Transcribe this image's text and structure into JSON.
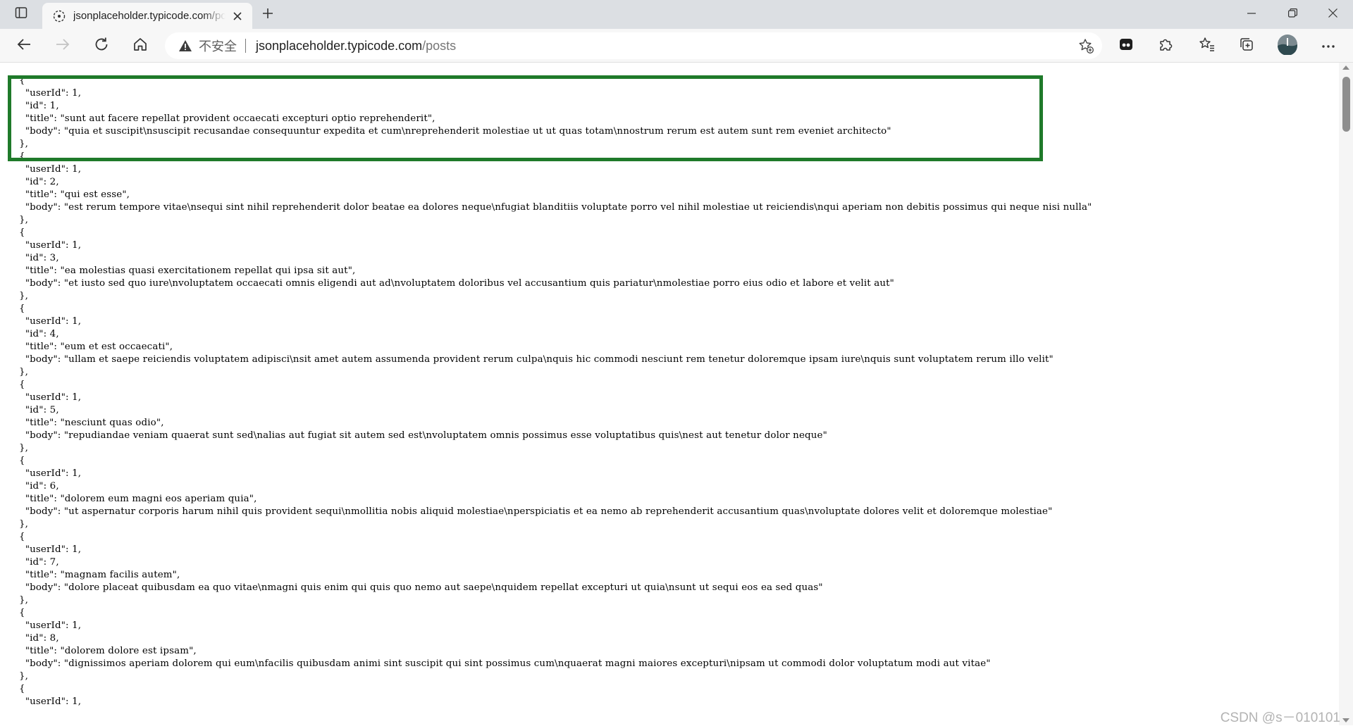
{
  "tab": {
    "title": "jsonplaceholder.typicode.com/posts"
  },
  "address_bar": {
    "security_label": "不安全",
    "host": "jsonplaceholder.typicode.com",
    "path": "/posts"
  },
  "icons": {
    "tab_actions": "tab-actions-icon",
    "favicon": "site-icon",
    "back": "back-arrow-icon",
    "forward": "forward-arrow-icon",
    "refresh": "refresh-icon",
    "home": "home-icon",
    "warning": "warning-icon",
    "add_favorite": "star-add-icon",
    "extensions": "puzzle-icon",
    "favorites": "favorites-icon",
    "collections": "collections-icon",
    "profile": "avatar",
    "menu": "more-icon"
  },
  "colors": {
    "highlight_border": "#1f7a2a"
  },
  "json_text": "{\n  \"userId\": 1,\n  \"id\": 1,\n  \"title\": \"sunt aut facere repellat provident occaecati excepturi optio reprehenderit\",\n  \"body\": \"quia et suscipit\\nsuscipit recusandae consequuntur expedita et cum\\nreprehenderit molestiae ut ut quas totam\\nnostrum rerum est autem sunt rem eveniet architecto\"\n},\n{\n  \"userId\": 1,\n  \"id\": 2,\n  \"title\": \"qui est esse\",\n  \"body\": \"est rerum tempore vitae\\nsequi sint nihil reprehenderit dolor beatae ea dolores neque\\nfugiat blanditiis voluptate porro vel nihil molestiae ut reiciendis\\nqui aperiam non debitis possimus qui neque nisi nulla\"\n},\n{\n  \"userId\": 1,\n  \"id\": 3,\n  \"title\": \"ea molestias quasi exercitationem repellat qui ipsa sit aut\",\n  \"body\": \"et iusto sed quo iure\\nvoluptatem occaecati omnis eligendi aut ad\\nvoluptatem doloribus vel accusantium quis pariatur\\nmolestiae porro eius odio et labore et velit aut\"\n},\n{\n  \"userId\": 1,\n  \"id\": 4,\n  \"title\": \"eum et est occaecati\",\n  \"body\": \"ullam et saepe reiciendis voluptatem adipisci\\nsit amet autem assumenda provident rerum culpa\\nquis hic commodi nesciunt rem tenetur doloremque ipsam iure\\nquis sunt voluptatem rerum illo velit\"\n},\n{\n  \"userId\": 1,\n  \"id\": 5,\n  \"title\": \"nesciunt quas odio\",\n  \"body\": \"repudiandae veniam quaerat sunt sed\\nalias aut fugiat sit autem sed est\\nvoluptatem omnis possimus esse voluptatibus quis\\nest aut tenetur dolor neque\"\n},\n{\n  \"userId\": 1,\n  \"id\": 6,\n  \"title\": \"dolorem eum magni eos aperiam quia\",\n  \"body\": \"ut aspernatur corporis harum nihil quis provident sequi\\nmollitia nobis aliquid molestiae\\nperspiciatis et ea nemo ab reprehenderit accusantium quas\\nvoluptate dolores velit et doloremque molestiae\"\n},\n{\n  \"userId\": 1,\n  \"id\": 7,\n  \"title\": \"magnam facilis autem\",\n  \"body\": \"dolore placeat quibusdam ea quo vitae\\nmagni quis enim qui quis quo nemo aut saepe\\nquidem repellat excepturi ut quia\\nsunt ut sequi eos ea sed quas\"\n},\n{\n  \"userId\": 1,\n  \"id\": 8,\n  \"title\": \"dolorem dolore est ipsam\",\n  \"body\": \"dignissimos aperiam dolorem qui eum\\nfacilis quibusdam animi sint suscipit qui sint possimus cum\\nquaerat magni maiores excepturi\\nipsam ut commodi dolor voluptatum modi aut vitae\"\n},\n{\n  \"userId\": 1,",
  "watermark": "CSDN @s－010101"
}
